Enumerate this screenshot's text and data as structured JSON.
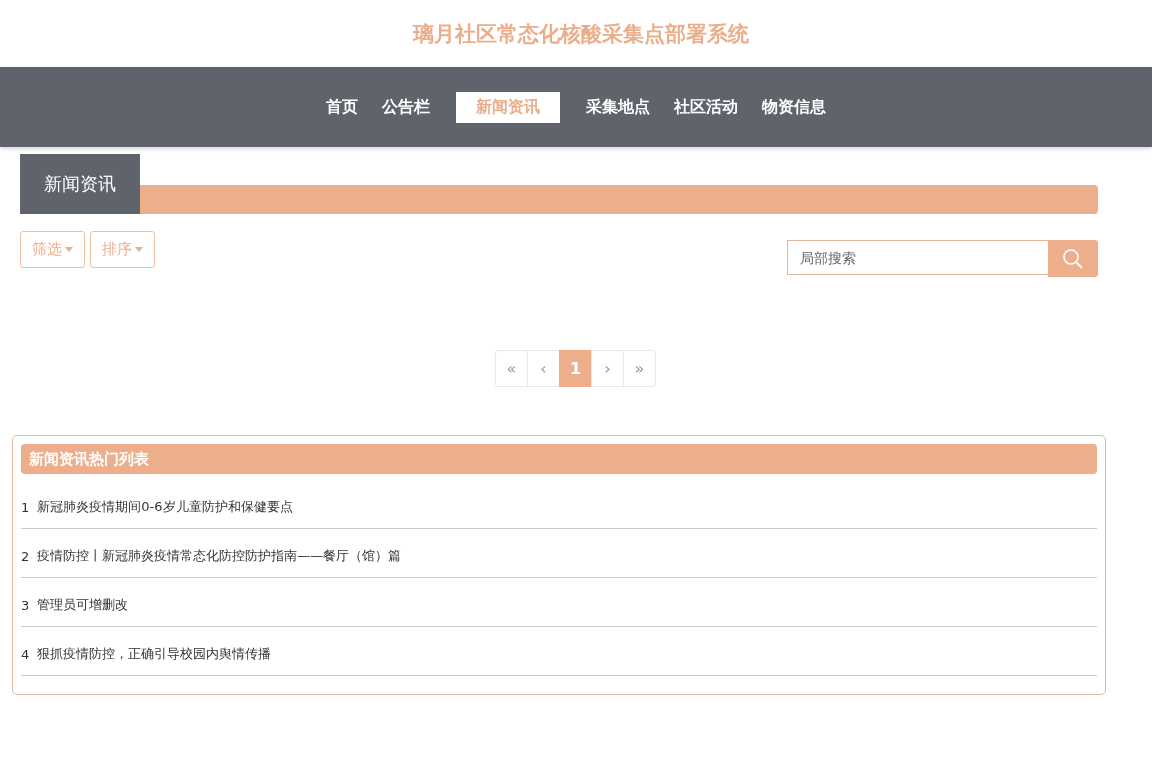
{
  "site_title": "璃月社区常态化核酸采集点部署系统",
  "nav": [
    {
      "label": "首页",
      "selected": false
    },
    {
      "label": "公告栏",
      "selected": false
    },
    {
      "label": "新闻资讯",
      "selected": true
    },
    {
      "label": "采集地点",
      "selected": false
    },
    {
      "label": "社区活动",
      "selected": false
    },
    {
      "label": "物资信息",
      "selected": false
    }
  ],
  "section_title": "新闻资讯",
  "filters": [
    {
      "label": "筛选"
    },
    {
      "label": "排序"
    }
  ],
  "search": {
    "placeholder": "局部搜索"
  },
  "pagination": [
    {
      "label": "«",
      "kind": "nav",
      "selected": false
    },
    {
      "label": "‹",
      "kind": "nav",
      "selected": false
    },
    {
      "label": "1",
      "kind": "page",
      "selected": true
    },
    {
      "label": "›",
      "kind": "nav",
      "selected": false
    },
    {
      "label": "»",
      "kind": "nav",
      "selected": false
    }
  ],
  "hot_list": {
    "title": "新闻资讯热门列表",
    "items": [
      {
        "index": "1",
        "title": "新冠肺炎疫情期间0-6岁儿童防护和保健要点"
      },
      {
        "index": "2",
        "title": "疫情防控丨新冠肺炎疫情常态化防控防护指南——餐厅（馆）篇"
      },
      {
        "index": "3",
        "title": "管理员可增删改"
      },
      {
        "index": "4",
        "title": "狠抓疫情防控，正确引导校园内舆情传播"
      }
    ]
  }
}
